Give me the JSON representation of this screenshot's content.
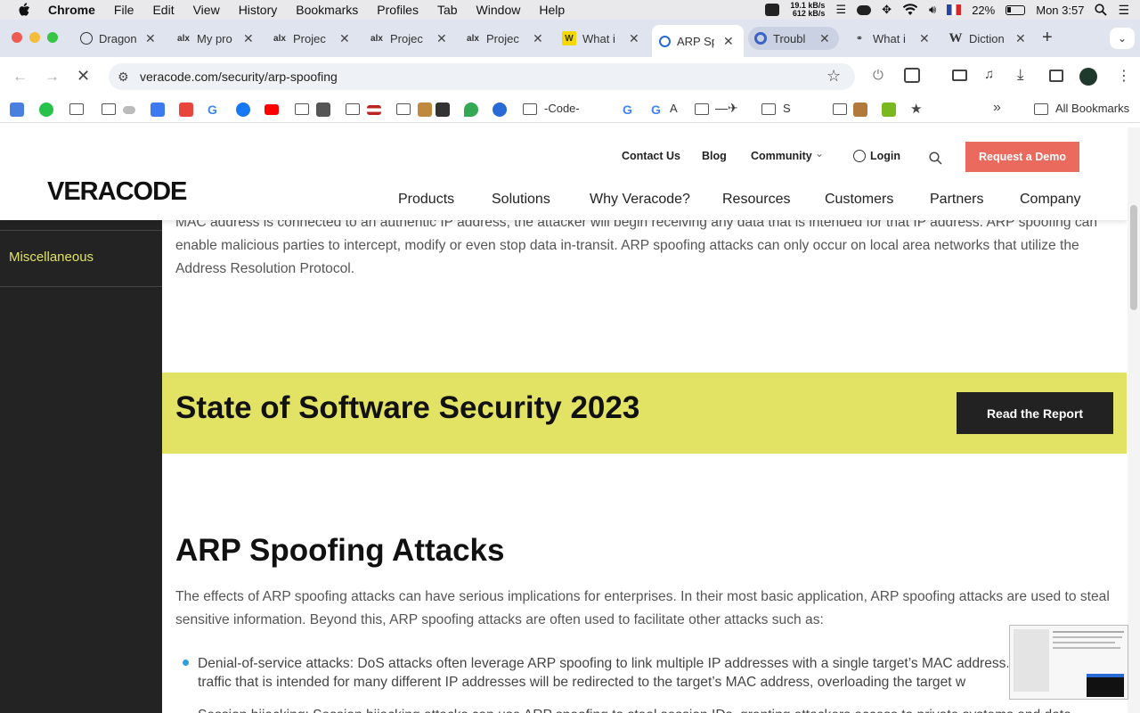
{
  "menubar": {
    "app": "Chrome",
    "items": [
      "File",
      "Edit",
      "View",
      "History",
      "Bookmarks",
      "Profiles",
      "Tab",
      "Window",
      "Help"
    ],
    "net_up": "19.1 kB/s",
    "net_down": "612 kB/s",
    "battery": "22%",
    "clock": "Mon 3:57"
  },
  "tabs": [
    {
      "title": "Dragon",
      "icon": "chatgpt-icon"
    },
    {
      "title": "My pro",
      "icon": "alx-icon"
    },
    {
      "title": "Projec",
      "icon": "alx-icon"
    },
    {
      "title": "Projec",
      "icon": "alx-icon"
    },
    {
      "title": "Projec",
      "icon": "alx-icon"
    },
    {
      "title": "What i",
      "icon": "w-icon"
    },
    {
      "title": "ARP Sp",
      "icon": "veracode-icon"
    },
    {
      "title": "Troubl",
      "icon": "chrome-icon"
    },
    {
      "title": "What i",
      "icon": "link-icon"
    },
    {
      "title": "Diction",
      "icon": "wikipedia-icon"
    }
  ],
  "toolbar": {
    "url": "veracode.com/security/arp-spoofing"
  },
  "bookmarks": {
    "items": [
      "-Code-",
      "A",
      "S",
      "All Bookmarks"
    ]
  },
  "site": {
    "logo": "VERACODE",
    "util": {
      "contact": "Contact Us",
      "blog": "Blog",
      "community": "Community",
      "login": "Login",
      "demo": "Request a Demo"
    },
    "nav": [
      "Products",
      "Solutions",
      "Why Veracode?",
      "Resources",
      "Customers",
      "Partners",
      "Company"
    ],
    "sidebar_item": "Miscellaneous",
    "para1": "MAC address is connected to an authentic IP address, the attacker will begin receiving any data that is intended for that IP address. ARP spoofing can enable malicious parties to intercept, modify or even stop data in-transit. ARP spoofing attacks can only occur on local area networks that utilize the Address Resolution Protocol.",
    "banner_title": "State of Software Security 2023",
    "banner_button": "Read the Report",
    "h2": "ARP Spoofing Attacks",
    "para2": "The effects of ARP spoofing attacks can have serious implications for enterprises. In their most basic application, ARP spoofing attacks are used to steal sensitive information. Beyond this, ARP spoofing attacks are often used to facilitate other attacks such as:",
    "bullet1_line1": "Denial-of-service attacks: DoS attacks often leverage ARP spoofing to link multiple IP addresses with a single target’s MAC address.",
    "bullet1_line2": "traffic that is intended for many different IP addresses will be redirected to the target’s MAC address, overloading the target w",
    "bullet2": "Session hijacking: Session hijacking attacks can use ARP spoofing to steal session IDs, granting attackers access to private systems and data."
  }
}
